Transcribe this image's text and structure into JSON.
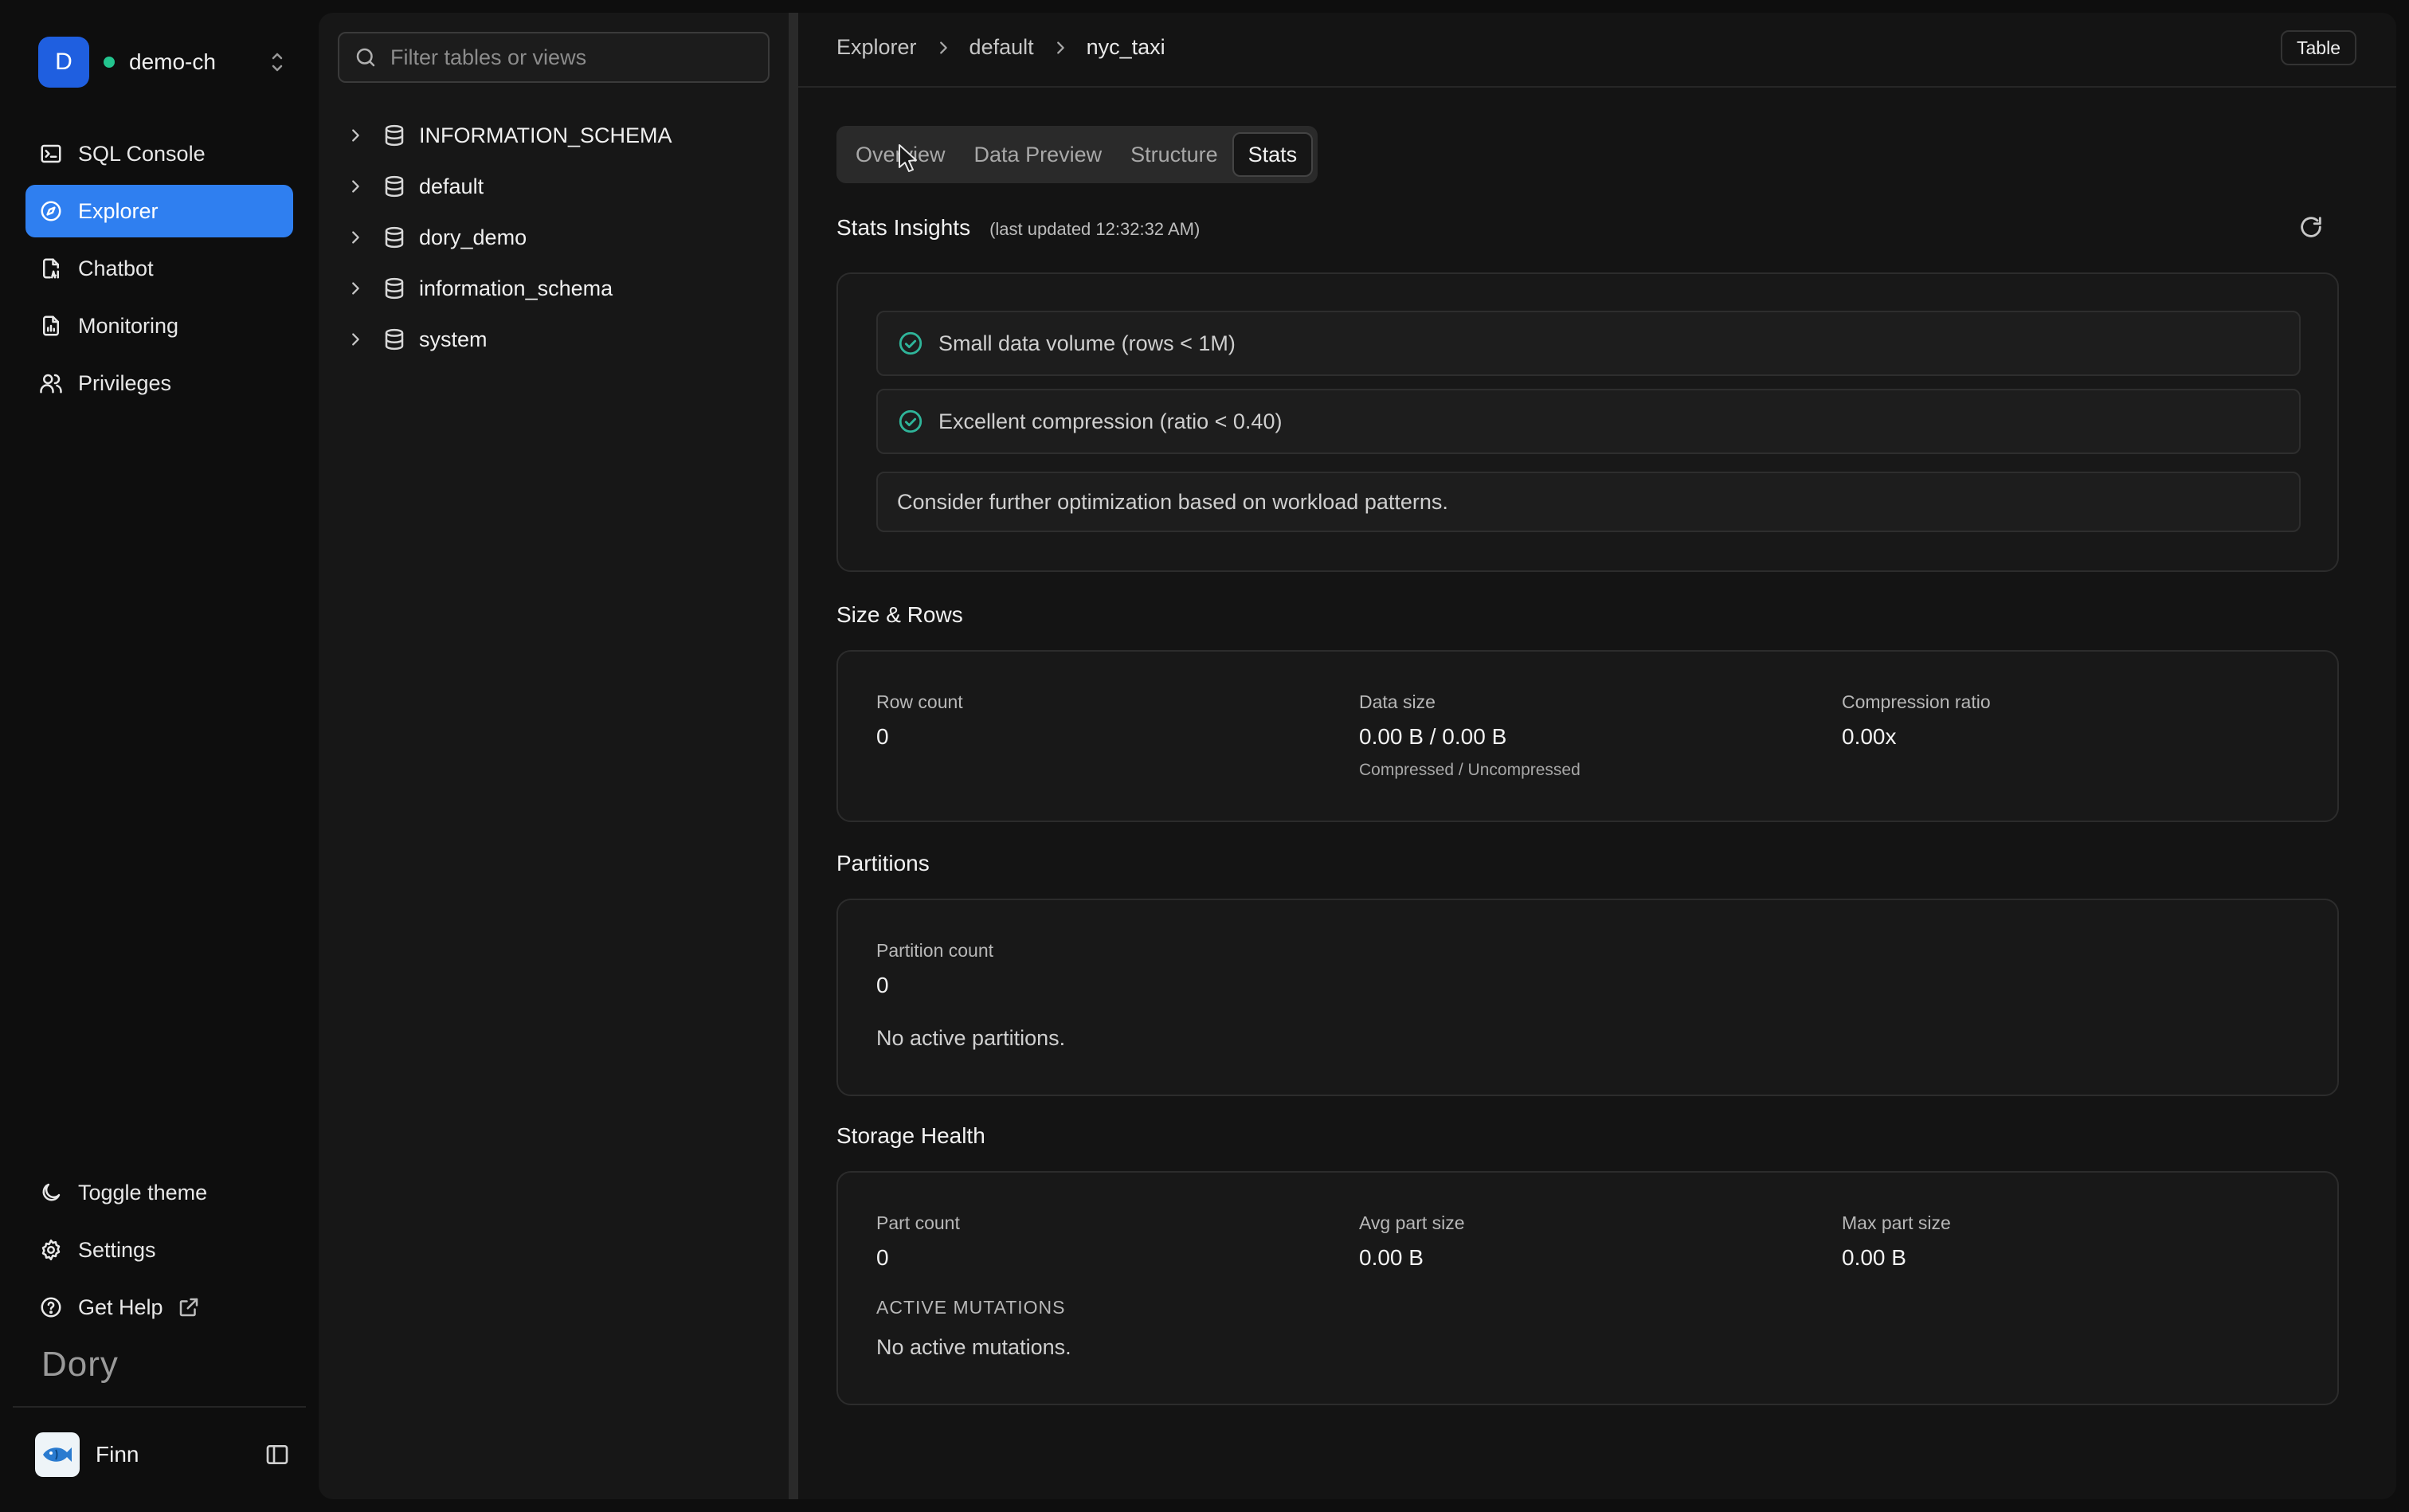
{
  "workspace": {
    "initial": "D",
    "name": "demo-ch",
    "status_color": "#23c48e"
  },
  "nav": [
    {
      "label": "SQL Console",
      "icon": "sql-console-icon"
    },
    {
      "label": "Explorer",
      "icon": "compass-icon",
      "active": true
    },
    {
      "label": "Chatbot",
      "icon": "chatbot-icon"
    },
    {
      "label": "Monitoring",
      "icon": "monitoring-icon"
    },
    {
      "label": "Privileges",
      "icon": "users-icon"
    }
  ],
  "bottom_nav": [
    {
      "label": "Toggle theme",
      "icon": "moon-icon"
    },
    {
      "label": "Settings",
      "icon": "gear-icon"
    },
    {
      "label": "Get Help",
      "icon": "help-circle-icon",
      "trailing_icon": "external-link-icon"
    }
  ],
  "brand": "Dory",
  "user": {
    "name": "Finn",
    "avatar_icon": "fish-avatar-icon"
  },
  "search": {
    "placeholder": "Filter tables or views"
  },
  "tree": [
    {
      "label": "INFORMATION_SCHEMA"
    },
    {
      "label": "default"
    },
    {
      "label": "dory_demo"
    },
    {
      "label": "information_schema"
    },
    {
      "label": "system"
    }
  ],
  "breadcrumb": [
    "Explorer",
    "default",
    "nyc_taxi"
  ],
  "object_type": "Table",
  "tabs": [
    {
      "label": "Overview"
    },
    {
      "label": "Data Preview"
    },
    {
      "label": "Structure"
    },
    {
      "label": "Stats",
      "active": true
    }
  ],
  "insights": {
    "title": "Stats Insights",
    "updated": "(last updated 12:32:32 AM)",
    "items": [
      {
        "text": "Small data volume (rows < 1M)",
        "ok": true
      },
      {
        "text": "Excellent compression (ratio < 0.40)",
        "ok": true
      },
      {
        "text": "Consider further optimization based on workload patterns.",
        "ok": false
      }
    ]
  },
  "size_rows": {
    "title": "Size & Rows",
    "row_count_label": "Row count",
    "row_count": "0",
    "data_size_label": "Data size",
    "data_size": "0.00 B / 0.00 B",
    "data_size_sub": "Compressed / Uncompressed",
    "compression_label": "Compression ratio",
    "compression": "0.00x"
  },
  "partitions": {
    "title": "Partitions",
    "count_label": "Partition count",
    "count": "0",
    "empty": "No active partitions."
  },
  "storage": {
    "title": "Storage Health",
    "part_count_label": "Part count",
    "part_count": "0",
    "avg_label": "Avg part size",
    "avg": "0.00 B",
    "max_label": "Max part size",
    "max": "0.00 B",
    "mutations_label": "ACTIVE MUTATIONS",
    "mutations_empty": "No active mutations."
  },
  "colors": {
    "accent": "#2f7ff0",
    "ok": "#2fb59a",
    "panel": "#171717"
  }
}
